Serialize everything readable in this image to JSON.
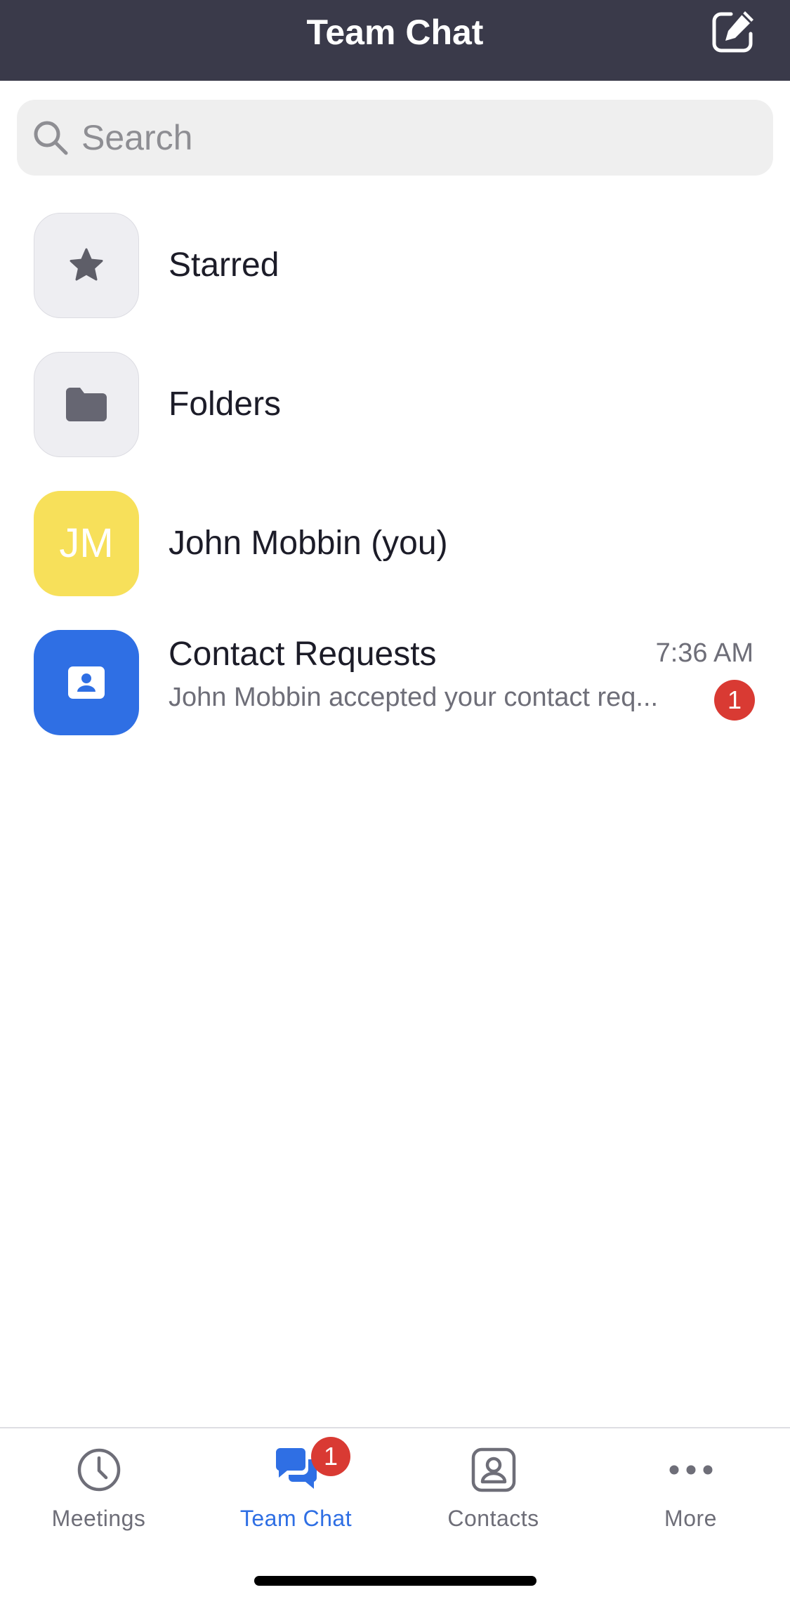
{
  "header": {
    "title": "Team Chat",
    "compose_icon": "compose-icon"
  },
  "search": {
    "placeholder": "Search",
    "value": "",
    "icon": "search-icon"
  },
  "list": {
    "starred": {
      "label": "Starred",
      "icon": "star-icon"
    },
    "folders": {
      "label": "Folders",
      "icon": "folder-icon"
    },
    "self": {
      "label": "John Mobbin (you)",
      "initials": "JM",
      "avatar_color": "#f7e05a"
    },
    "contact_requests": {
      "label": "Contact Requests",
      "time": "7:36 AM",
      "preview": "John Mobbin accepted your contact req...",
      "unread": "1",
      "icon": "contact-card-icon",
      "icon_color": "#2f6fe4"
    }
  },
  "tabbar": {
    "tabs": [
      {
        "label": "Meetings",
        "icon": "clock-icon"
      },
      {
        "label": "Team Chat",
        "icon": "chat-bubbles-icon",
        "badge": "1",
        "active": true
      },
      {
        "label": "Contacts",
        "icon": "contact-icon"
      },
      {
        "label": "More",
        "icon": "more-dots-icon"
      }
    ]
  },
  "colors": {
    "header_bg": "#3a3a4a",
    "accent": "#2f6fe4",
    "badge": "#d93a33"
  }
}
